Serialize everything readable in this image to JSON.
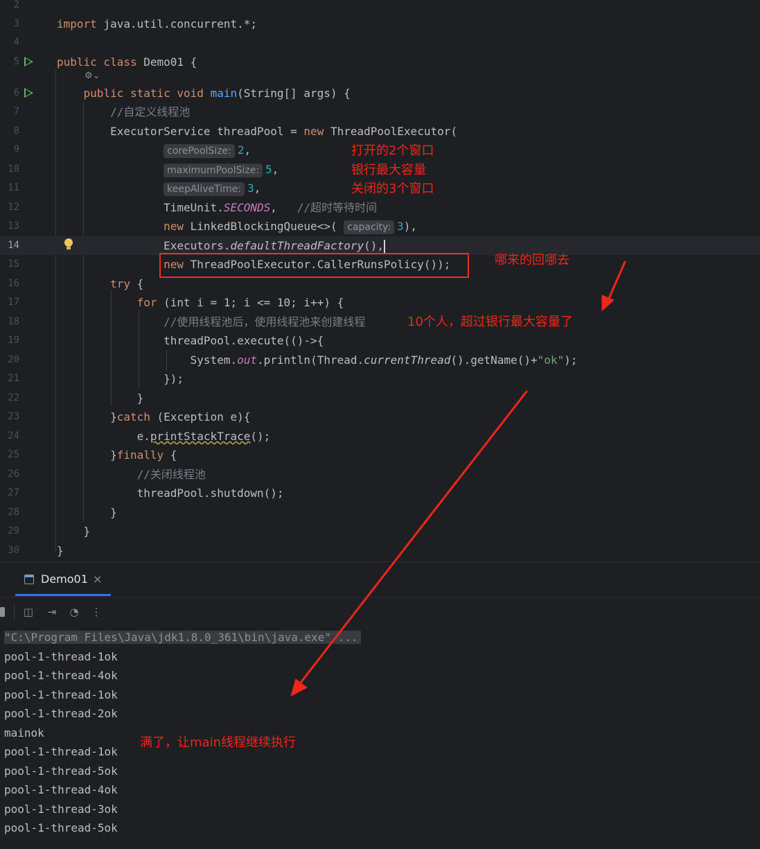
{
  "editor": {
    "lines": [
      {
        "no": "2"
      },
      {
        "no": "3"
      },
      {
        "no": "4"
      },
      {
        "no": "5"
      },
      {
        "no": "6"
      },
      {
        "no": "7"
      },
      {
        "no": "8"
      },
      {
        "no": "9"
      },
      {
        "no": "10"
      },
      {
        "no": "11"
      },
      {
        "no": "12"
      },
      {
        "no": "13"
      },
      {
        "no": "14"
      },
      {
        "no": "15"
      },
      {
        "no": "16"
      },
      {
        "no": "17"
      },
      {
        "no": "18"
      },
      {
        "no": "19"
      },
      {
        "no": "20"
      },
      {
        "no": "21"
      },
      {
        "no": "22"
      },
      {
        "no": "23"
      },
      {
        "no": "24"
      },
      {
        "no": "25"
      },
      {
        "no": "26"
      },
      {
        "no": "27"
      },
      {
        "no": "28"
      },
      {
        "no": "29"
      },
      {
        "no": "30"
      }
    ],
    "current_line": "14",
    "code": {
      "import_kw": "import",
      "import_path": " java.util.concurrent.*;",
      "public_class": "public class",
      "class_name": " Demo01 {",
      "main_sig_kw": "public static void",
      "main_name": "main",
      "main_params": "(String[] args) {",
      "comment_custom_pool": "//自定义线程池",
      "executor_decl": "ExecutorService threadPool = ",
      "new_kw": "new",
      "tpe_ctor": " ThreadPoolExecutor(",
      "hint_core": "corePoolSize:",
      "val_core": "2",
      "hint_max": "maximumPoolSize:",
      "val_max": "5",
      "hint_keep": "keepAliveTime:",
      "val_keep": "3",
      "timeunit": "TimeUnit.",
      "seconds": "SECONDS",
      "comment_timeout": "//超时等待时间",
      "lbq": " LinkedBlockingQueue<>(",
      "hint_capacity": "capacity:",
      "val_capacity": "3",
      "executors": "Executors.",
      "default_factory": "defaultThreadFactory",
      "policy": " ThreadPoolExecutor.CallerRunsPolicy());",
      "try_kw": "try",
      "for_kw": "for",
      "for_body": " (int i = 1; i <= 10; i++) {",
      "comment_use_pool": "//使用线程池后，使用线程池来创建线程",
      "execute_call": "threadPool.execute(()->{",
      "println_a": "System.",
      "out_field": "out",
      "println_b": ".println(Thread.",
      "current_thread": "currentThread",
      "println_c": "().getName()+",
      "ok_str": "\"ok\"",
      "println_end": ");",
      "lambda_close": "});",
      "brace_close": "}",
      "catch_kw": "catch",
      "catch_args": " (Exception e){",
      "print_stack_a": "e.",
      "print_stack_fn": "printStackTrace",
      "print_stack_b": "();",
      "finally_kw": "finally",
      "comment_close_pool": "//关闭线程池",
      "shutdown": "threadPool.shutdown();"
    }
  },
  "annotations": {
    "open_windows": "打开的2个窗口",
    "bank_max": "银行最大容量",
    "closed_windows": "关闭的3个窗口",
    "where_from": "哪来的回哪去",
    "ten_people": "10个人，超过银行最大容量了",
    "main_continue": "满了，让main线程继续执行",
    "color": "#f0261a"
  },
  "run_panel": {
    "tab_label": "Demo01",
    "command": "\"C:\\Program Files\\Java\\jdk1.8.0_361\\bin\\java.exe\" ...",
    "output": [
      "pool-1-thread-1ok",
      "pool-1-thread-4ok",
      "pool-1-thread-1ok",
      "pool-1-thread-2ok",
      "mainok",
      "pool-1-thread-1ok",
      "pool-1-thread-5ok",
      "pool-1-thread-4ok",
      "pool-1-thread-3ok",
      "pool-1-thread-5ok"
    ]
  }
}
